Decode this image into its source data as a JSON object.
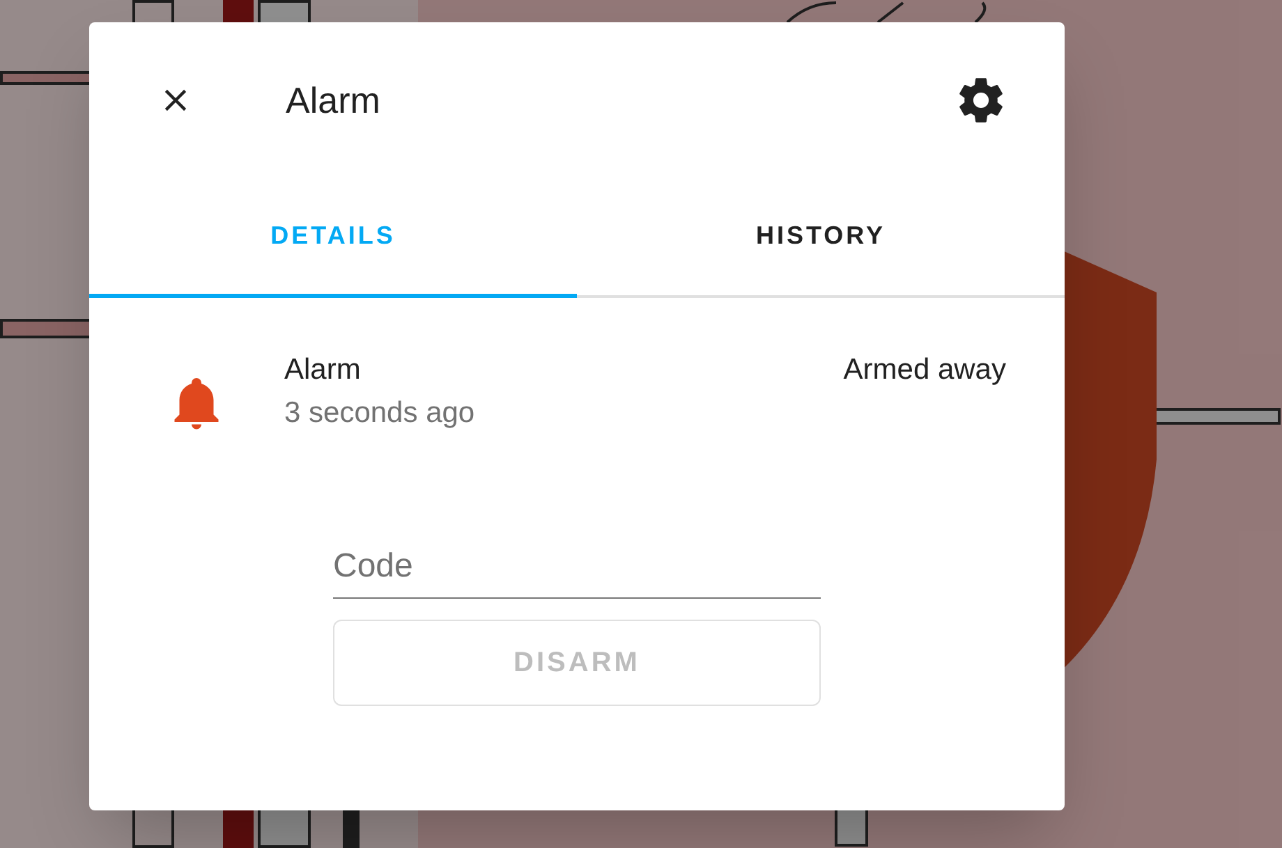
{
  "dialog": {
    "title": "Alarm"
  },
  "tabs": [
    {
      "label": "DETAILS",
      "selected": true
    },
    {
      "label": "HISTORY",
      "selected": false
    }
  ],
  "entity": {
    "name": "Alarm",
    "last_changed": "3 seconds ago",
    "state": "Armed away"
  },
  "code_field": {
    "placeholder": "Code"
  },
  "disarm_button": {
    "label": "DISARM",
    "disabled": true
  }
}
